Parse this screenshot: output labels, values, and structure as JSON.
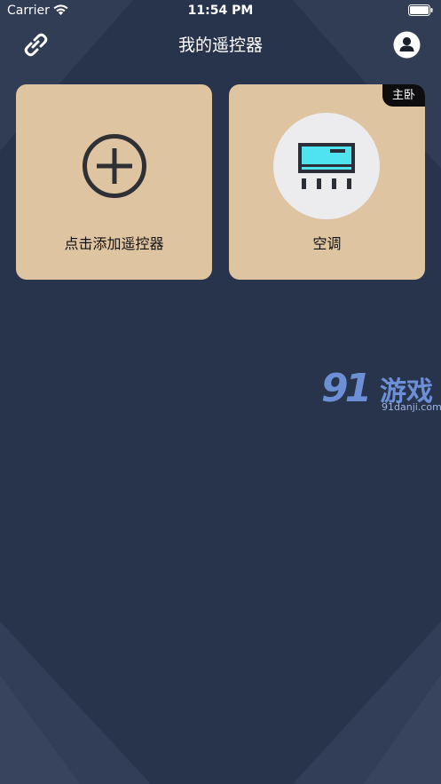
{
  "status_bar": {
    "carrier": "Carrier",
    "time": "11:54 PM"
  },
  "nav": {
    "title": "我的遥控器",
    "left_icon": "link-icon",
    "right_icon": "user-icon"
  },
  "cards": {
    "add": {
      "label": "点击添加遥控器",
      "icon": "plus-circle-icon"
    },
    "ac": {
      "label": "空调",
      "badge": "主卧",
      "icon": "air-conditioner-icon"
    }
  },
  "watermark": {
    "logo": "91",
    "brand": "游戏",
    "url": "91danji.com"
  },
  "colors": {
    "background": "#28334c",
    "card": "#dfc4a1",
    "badge": "#0d0d0f",
    "ac_screen": "#4fe3f0"
  }
}
